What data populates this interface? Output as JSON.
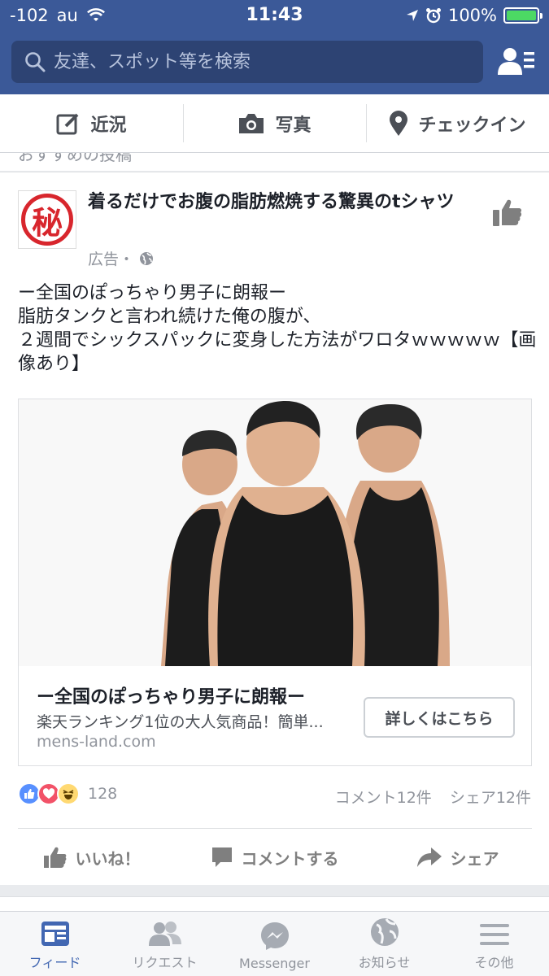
{
  "status_bar": {
    "signal": "-102",
    "carrier": "au",
    "time": "11:43",
    "battery": "100%",
    "battery_level": 1.0
  },
  "search": {
    "placeholder": "友達、スポット等を検索"
  },
  "composer": {
    "status_label": "近況",
    "photo_label": "写真",
    "checkin_label": "チェックイン"
  },
  "feed": {
    "cutoff_text": "おすすめの投稿",
    "post": {
      "avatar_char": "秘",
      "title": "着るだけでお腹の脂肪燃焼する驚異のtシャツ",
      "sponsored": "広告・",
      "body": "ー全国のぽっちゃり男子に朗報ー\n脂肪タンクと言われ続けた俺の腹が、\n２週間でシックスパックに変身した方法がワロタｗｗｗｗｗ【画像あり】",
      "link": {
        "title": "ー全国のぽっちゃり男子に朗報ー",
        "description": "楽天ランキング1位の大人気商品！簡単...",
        "domain": "mens-land.com",
        "cta": "詳しくはこちら"
      },
      "reactions_count": "128",
      "comments_count": "コメント12件",
      "shares_count": "シェア12件",
      "actions": {
        "like": "いいね！",
        "comment": "コメントする",
        "share": "シェア"
      }
    }
  },
  "tabbar": {
    "feed": "フィード",
    "requests": "リクエスト",
    "messenger": "Messenger",
    "notifications": "お知らせ",
    "more": "その他"
  },
  "colors": {
    "brand": "#3b5998",
    "active_tab": "#4267b2"
  }
}
